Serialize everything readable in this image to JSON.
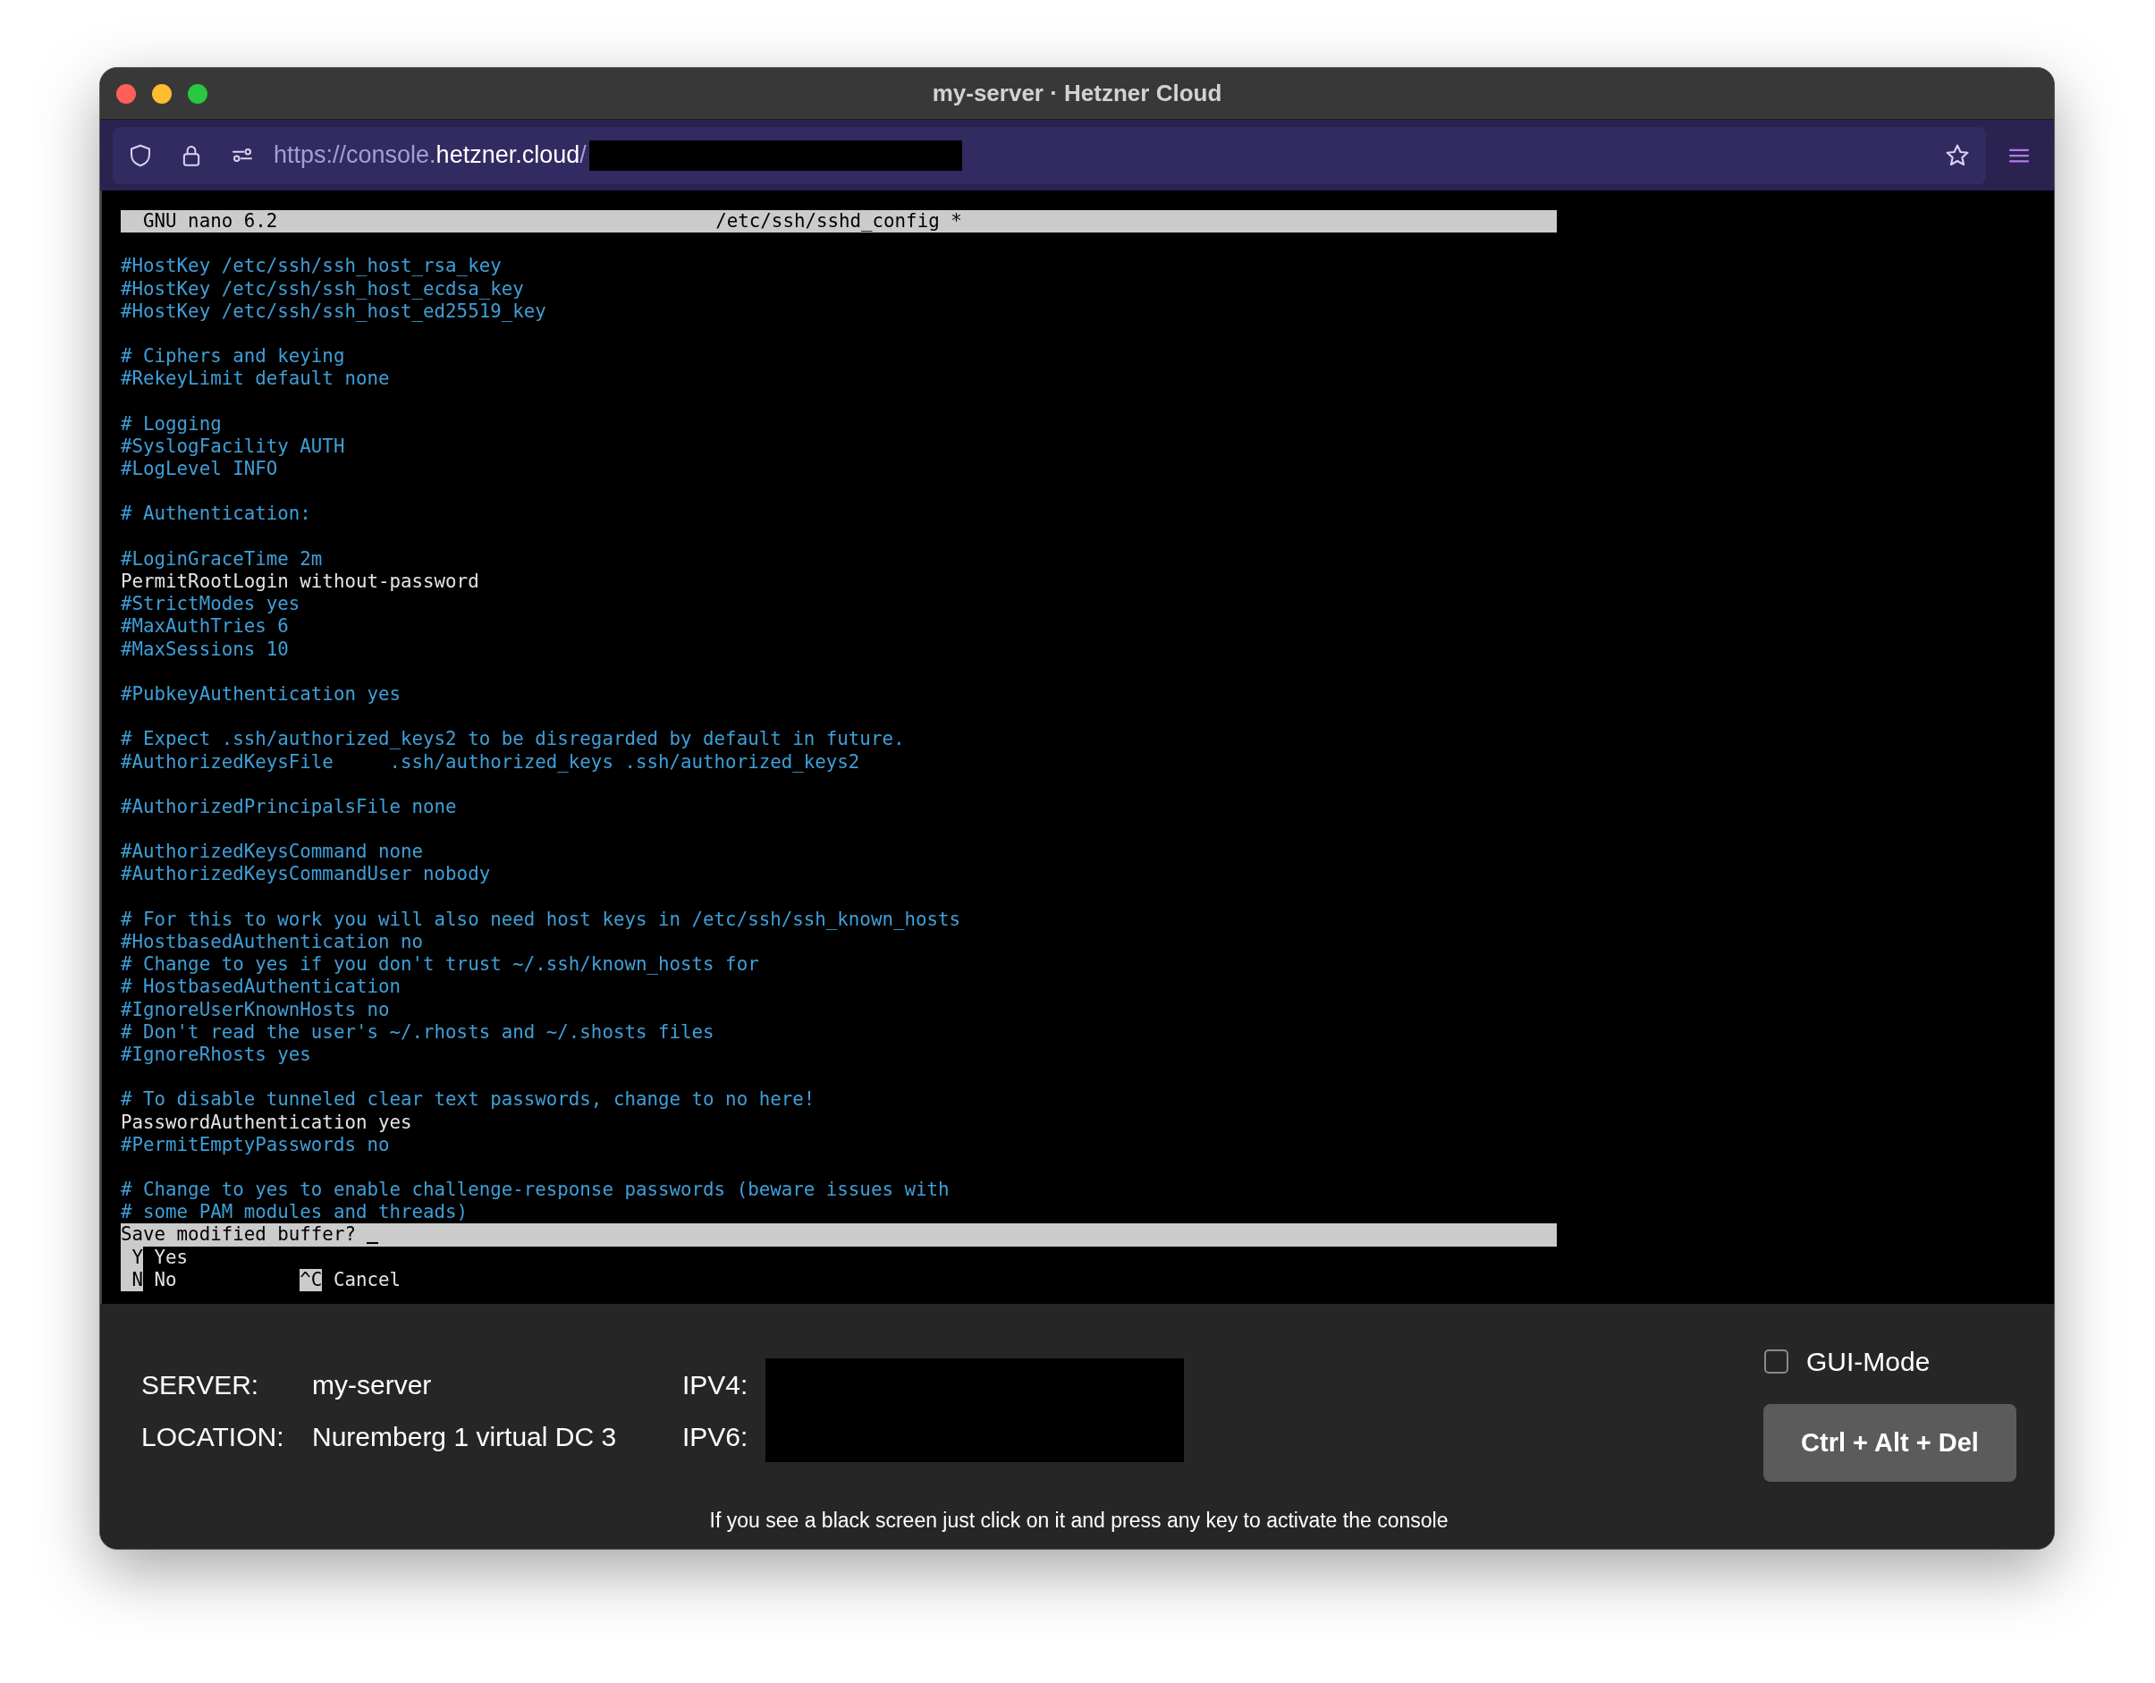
{
  "window": {
    "title": "my-server · Hetzner Cloud"
  },
  "address_bar": {
    "url": [
      {
        "text": "https://console.",
        "kind": "dim"
      },
      {
        "text": "hetzner.cloud",
        "kind": "host"
      },
      {
        "text": "/",
        "kind": "dim"
      }
    ],
    "redacted": true
  },
  "terminal": {
    "title_bar": {
      "app": "GNU nano 6.2",
      "file": "/etc/ssh/sshd_config *"
    },
    "lines": [
      {
        "kind": "blank"
      },
      {
        "kind": "comment",
        "text": "#HostKey /etc/ssh/ssh_host_rsa_key"
      },
      {
        "kind": "comment",
        "text": "#HostKey /etc/ssh/ssh_host_ecdsa_key"
      },
      {
        "kind": "comment",
        "text": "#HostKey /etc/ssh/ssh_host_ed25519_key"
      },
      {
        "kind": "blank"
      },
      {
        "kind": "comment",
        "text": "# Ciphers and keying"
      },
      {
        "kind": "comment",
        "text": "#RekeyLimit default none"
      },
      {
        "kind": "blank"
      },
      {
        "kind": "comment",
        "text": "# Logging"
      },
      {
        "kind": "comment",
        "text": "#SyslogFacility AUTH"
      },
      {
        "kind": "comment",
        "text": "#LogLevel INFO"
      },
      {
        "kind": "blank"
      },
      {
        "kind": "comment",
        "text": "# Authentication:"
      },
      {
        "kind": "blank"
      },
      {
        "kind": "comment",
        "text": "#LoginGraceTime 2m"
      },
      {
        "kind": "setting",
        "text": "PermitRootLogin without-password"
      },
      {
        "kind": "comment",
        "text": "#StrictModes yes"
      },
      {
        "kind": "comment",
        "text": "#MaxAuthTries 6"
      },
      {
        "kind": "comment",
        "text": "#MaxSessions 10"
      },
      {
        "kind": "blank"
      },
      {
        "kind": "comment",
        "text": "#PubkeyAuthentication yes"
      },
      {
        "kind": "blank"
      },
      {
        "kind": "comment",
        "text": "# Expect .ssh/authorized_keys2 to be disregarded by default in future."
      },
      {
        "kind": "comment",
        "text": "#AuthorizedKeysFile     .ssh/authorized_keys .ssh/authorized_keys2"
      },
      {
        "kind": "blank"
      },
      {
        "kind": "comment",
        "text": "#AuthorizedPrincipalsFile none"
      },
      {
        "kind": "blank"
      },
      {
        "kind": "comment",
        "text": "#AuthorizedKeysCommand none"
      },
      {
        "kind": "comment",
        "text": "#AuthorizedKeysCommandUser nobody"
      },
      {
        "kind": "blank"
      },
      {
        "kind": "comment",
        "text": "# For this to work you will also need host keys in /etc/ssh/ssh_known_hosts"
      },
      {
        "kind": "comment",
        "text": "#HostbasedAuthentication no"
      },
      {
        "kind": "comment",
        "text": "# Change to yes if you don't trust ~/.ssh/known_hosts for"
      },
      {
        "kind": "comment",
        "text": "# HostbasedAuthentication"
      },
      {
        "kind": "comment",
        "text": "#IgnoreUserKnownHosts no"
      },
      {
        "kind": "comment",
        "text": "# Don't read the user's ~/.rhosts and ~/.shosts files"
      },
      {
        "kind": "comment",
        "text": "#IgnoreRhosts yes"
      },
      {
        "kind": "blank"
      },
      {
        "kind": "comment",
        "text": "# To disable tunneled clear text passwords, change to no here!"
      },
      {
        "kind": "setting",
        "text": "PasswordAuthentication yes"
      },
      {
        "kind": "comment",
        "text": "#PermitEmptyPasswords no"
      },
      {
        "kind": "blank"
      },
      {
        "kind": "comment",
        "text": "# Change to yes to enable challenge-response passwords (beware issues with"
      },
      {
        "kind": "comment",
        "text": "# some PAM modules and threads)"
      }
    ],
    "prompt": {
      "text": "Save modified buffer?",
      "cursor": true
    },
    "shortcut_rows": [
      [
        {
          "key": "Y",
          "label": "Yes"
        }
      ],
      [
        {
          "key": "N",
          "label": "No"
        },
        {
          "key": "^C",
          "label": "Cancel"
        }
      ]
    ]
  },
  "footer": {
    "server_label": "SERVER:",
    "server": "my-server",
    "location_label": "LOCATION:",
    "location": "Nuremberg 1 virtual DC 3",
    "ipv4_label": "IPV4:",
    "ipv6_label": "IPV6:",
    "addresses_redacted": true,
    "gui_mode": {
      "label": "GUI-Mode",
      "checked": false
    },
    "button": "Ctrl + Alt + Del",
    "hint": "If you see a black screen just click on it and press any key to activate the console"
  }
}
